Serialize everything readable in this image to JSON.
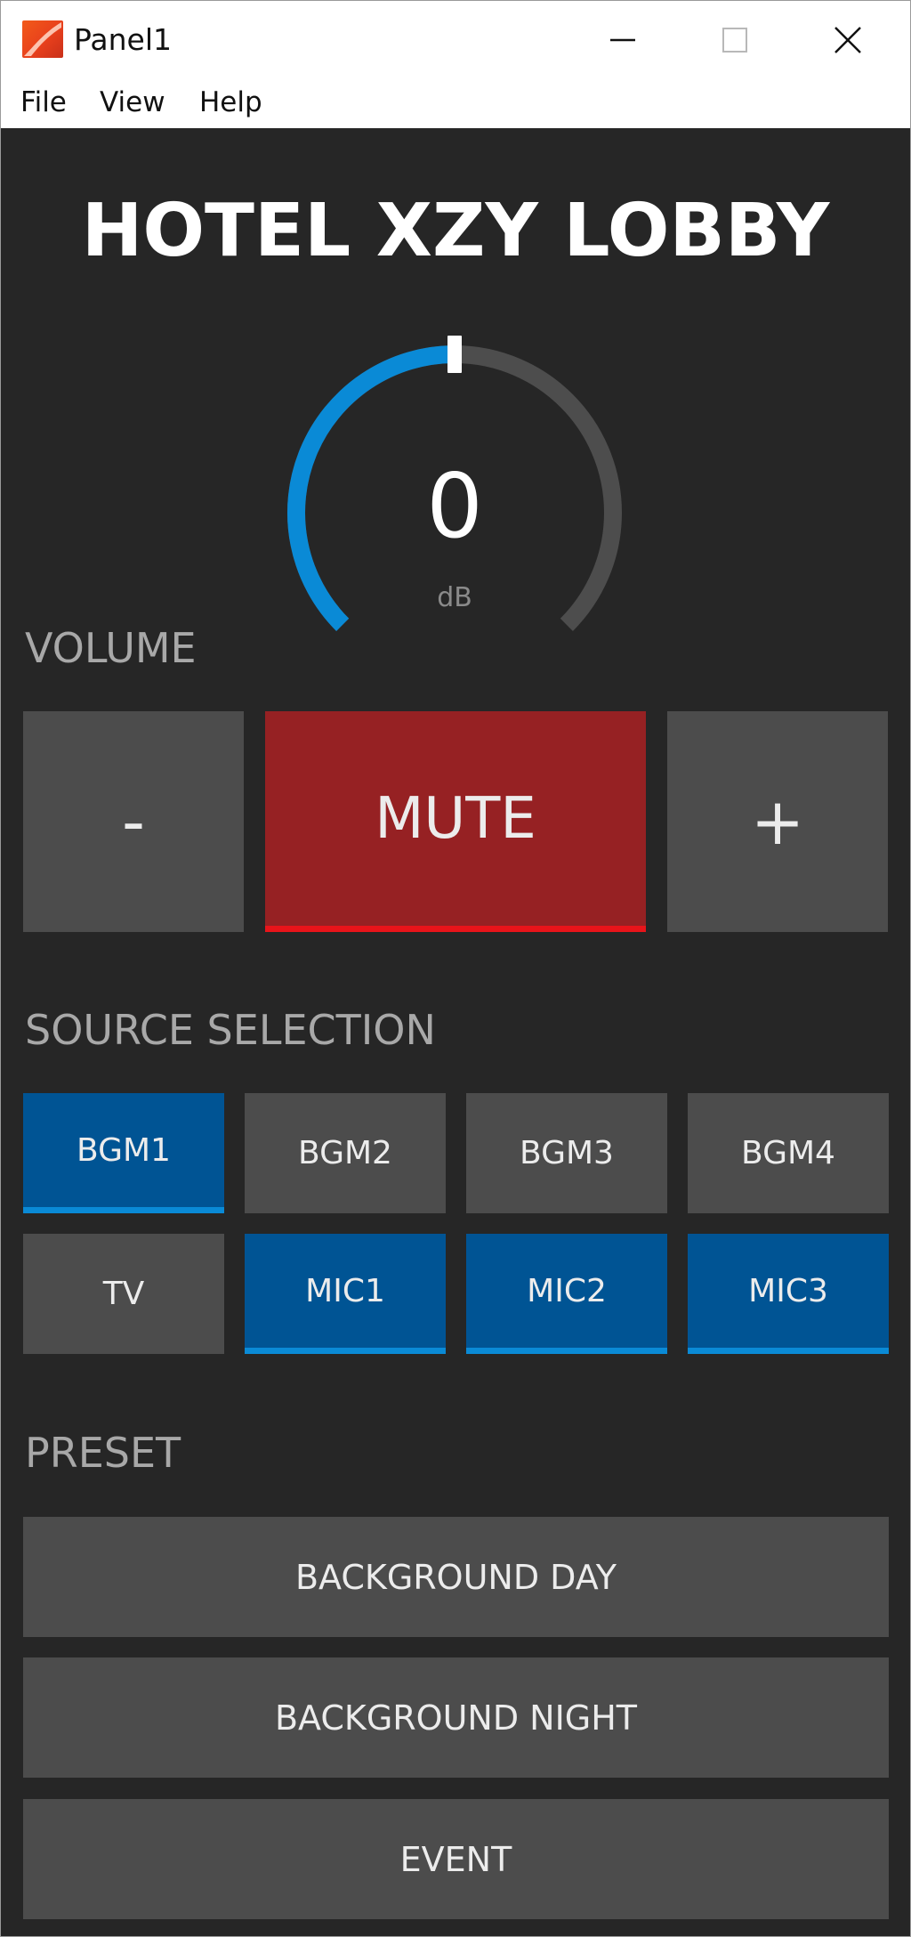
{
  "window": {
    "title": "Panel1",
    "icons": {
      "app": "app-logo-icon",
      "minimize": "minimize-icon",
      "maximize": "maximize-icon",
      "close": "close-icon"
    }
  },
  "menu": [
    "File",
    "View",
    "Help"
  ],
  "panel": {
    "title": "HOTEL XZY LOBBY",
    "volume": {
      "label": "VOLUME",
      "value": "0",
      "unit": "dB",
      "level_fraction": 0.5,
      "minus_label": "-",
      "mute_label": "MUTE",
      "mute_active": true,
      "plus_label": "+"
    },
    "source": {
      "label": "SOURCE SELECTION",
      "buttons": [
        {
          "label": "BGM1",
          "active": true
        },
        {
          "label": "BGM2",
          "active": false
        },
        {
          "label": "BGM3",
          "active": false
        },
        {
          "label": "BGM4",
          "active": false
        },
        {
          "label": "TV",
          "active": false
        },
        {
          "label": "MIC1",
          "active": true
        },
        {
          "label": "MIC2",
          "active": true
        },
        {
          "label": "MIC3",
          "active": true
        }
      ]
    },
    "preset": {
      "label": "PRESET",
      "buttons": [
        "BACKGROUND DAY",
        "BACKGROUND NIGHT",
        "EVENT"
      ]
    }
  },
  "colors": {
    "background": "#262626",
    "button": "#4c4c4c",
    "active_blue": "#005494",
    "active_blue_accent": "#0a8ad6",
    "mute_red": "#962123",
    "mute_red_accent": "#e8141a",
    "gauge_fill": "#0a8ad6",
    "gauge_track": "#4d4d4d"
  }
}
